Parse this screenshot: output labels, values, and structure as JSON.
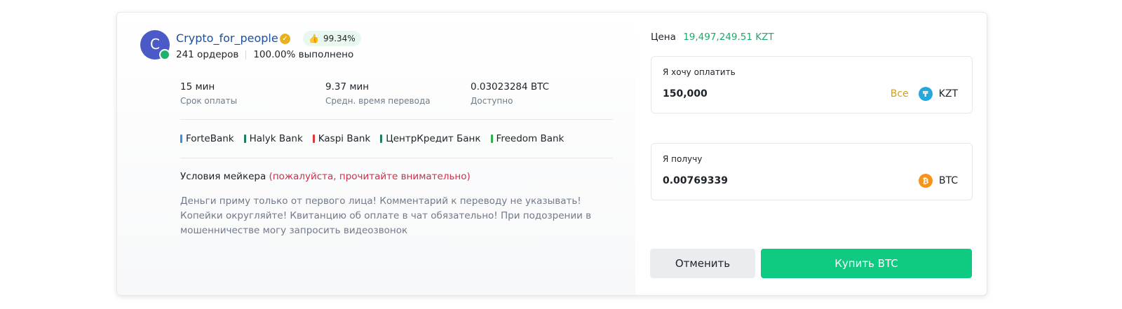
{
  "advertiser": {
    "avatar_letter": "C",
    "name": "Crypto_for_people",
    "rating": "99.34%",
    "orders": "241 ордеров",
    "completion": "100.00% выполнено"
  },
  "info": [
    {
      "value": "15 мин",
      "label": "Срок оплаты"
    },
    {
      "value": "9.37 мин",
      "label": "Средн. время перевода"
    },
    {
      "value": "0.03023284 BTC",
      "label": "Доступно"
    }
  ],
  "banks": [
    {
      "name": "ForteBank",
      "color": "#3b8fd6"
    },
    {
      "name": "Halyk Bank",
      "color": "#1a7f5a"
    },
    {
      "name": "Kaspi Bank",
      "color": "#e0353b"
    },
    {
      "name": "ЦентрКредит Банк",
      "color": "#1a7f5a"
    },
    {
      "name": "Freedom Bank",
      "color": "#2fae4e"
    }
  ],
  "terms": {
    "title": "Условия мейкера",
    "note": "(пожалуйста, прочитайте внимательно)",
    "text": "Деньги приму только от первого лица! Комментарий к переводу не указывать! Копейки округляйте! Квитанцию об оплате в чат обязательно! При подозрении в мошенничестве могу запросить видеозвонок"
  },
  "price": {
    "label": "Цена",
    "value": "19,497,249.51 KZT"
  },
  "pay_field": {
    "label": "Я хочу оплатить",
    "value": "150,000",
    "all_label": "Все",
    "currency": "KZT",
    "icon": "tenge-coin-icon"
  },
  "receive_field": {
    "label": "Я получу",
    "value": "0.00769339",
    "currency": "BTC",
    "icon": "bitcoin-coin-icon"
  },
  "buttons": {
    "cancel": "Отменить",
    "buy": "Купить BTC"
  },
  "colors": {
    "accent_green": "#0ecb81",
    "price_green": "#20a76a",
    "link_blue": "#1f4e96",
    "warning_red": "#cf304a"
  }
}
